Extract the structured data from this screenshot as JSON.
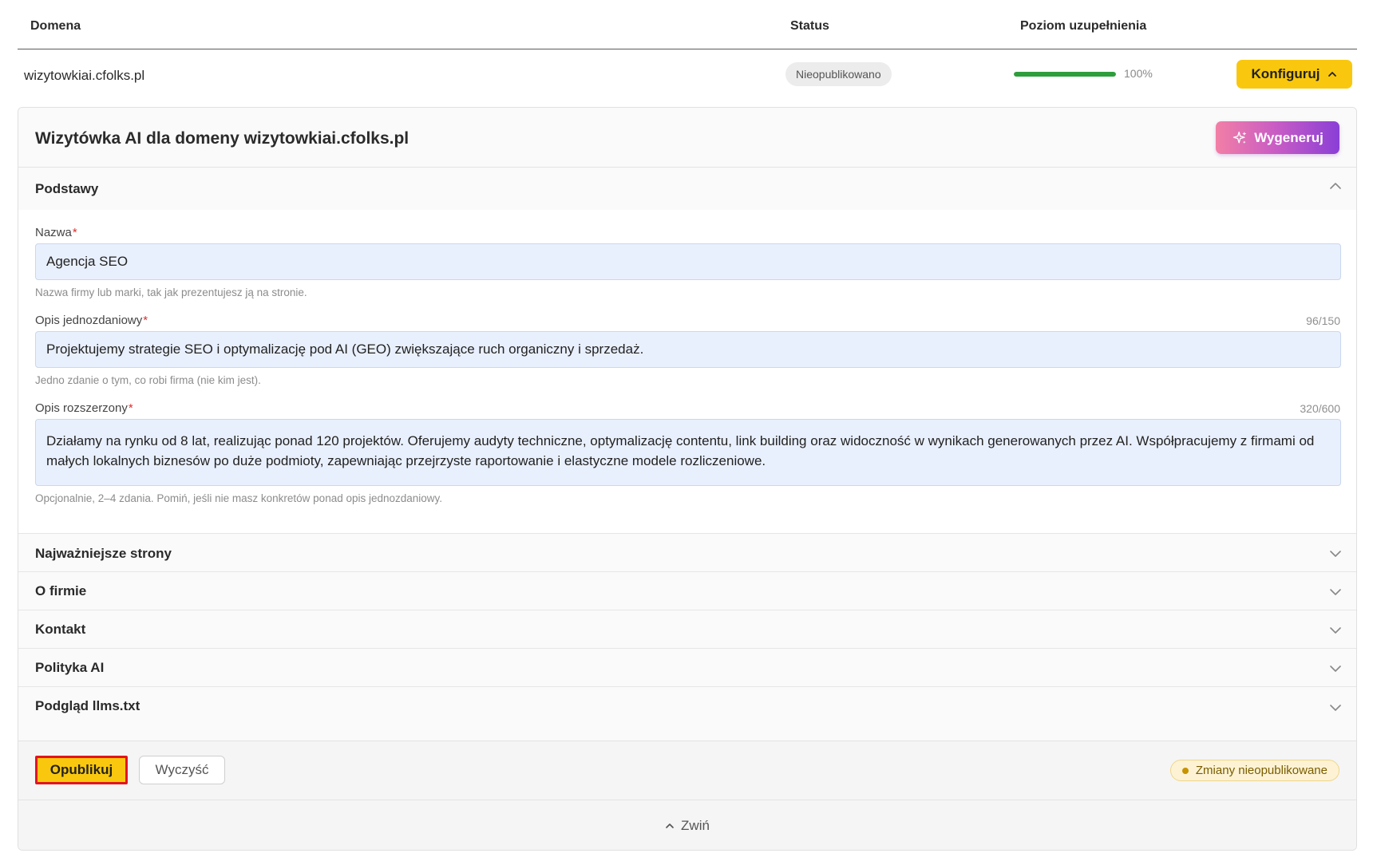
{
  "table": {
    "headers": {
      "domain": "Domena",
      "status": "Status",
      "level": "Poziom uzupełnienia"
    },
    "row": {
      "domain": "wizytowkiai.cfolks.pl",
      "status": "Nieopublikowano",
      "progress_percent": 100,
      "progress_label": "100%",
      "configure_label": "Konfiguruj"
    }
  },
  "card": {
    "title": "Wizytówka AI dla domeny wizytowkiai.cfolks.pl",
    "generate_label": "Wygeneruj",
    "sections": {
      "basics": "Podstawy",
      "pages": "Najważniejsze strony",
      "about": "O firmie",
      "contact": "Kontakt",
      "policy": "Polityka AI",
      "preview": "Podgląd llms.txt"
    },
    "fields": {
      "name": {
        "label": "Nazwa",
        "required": "*",
        "value": "Agencja SEO",
        "hint": "Nazwa firmy lub marki, tak jak prezentujesz ją na stronie."
      },
      "short_desc": {
        "label": "Opis jednozdaniowy",
        "required": "*",
        "counter": "96/150",
        "value": "Projektujemy strategie SEO i optymalizację pod AI (GEO) zwiększające ruch organiczny i sprzedaż.",
        "hint": "Jedno zdanie o tym, co robi firma (nie kim jest)."
      },
      "long_desc": {
        "label": "Opis rozszerzony",
        "required": "*",
        "counter": "320/600",
        "value": "Działamy na rynku od 8 lat, realizując ponad 120 projektów. Oferujemy audyty techniczne, optymalizację contentu, link building oraz widoczność w wynikach generowanych przez AI. Współpracujemy z firmami od małych lokalnych biznesów po duże podmioty, zapewniając przejrzyste raportowanie i elastyczne modele rozliczeniowe.",
        "hint": "Opcjonalnie, 2–4 zdania. Pomiń, jeśli nie masz konkretów ponad opis jednozdaniowy."
      }
    },
    "footer": {
      "publish_label": "Opublikuj",
      "clear_label": "Wyczyść",
      "unpublished_label": "Zmiany nieopublikowane"
    },
    "collapse_label": "Zwiń"
  },
  "colors": {
    "accent_yellow": "#f9c80e",
    "progress_green": "#2e9e3c",
    "highlight_red": "#e3141e",
    "input_bg": "#e9f0fd"
  },
  "icons": {
    "configure": "chevron-up-icon",
    "generate": "sparkles-icon",
    "section_open": "chevron-up-icon",
    "section_closed": "chevron-down-icon",
    "collapse": "chevron-up-icon"
  }
}
